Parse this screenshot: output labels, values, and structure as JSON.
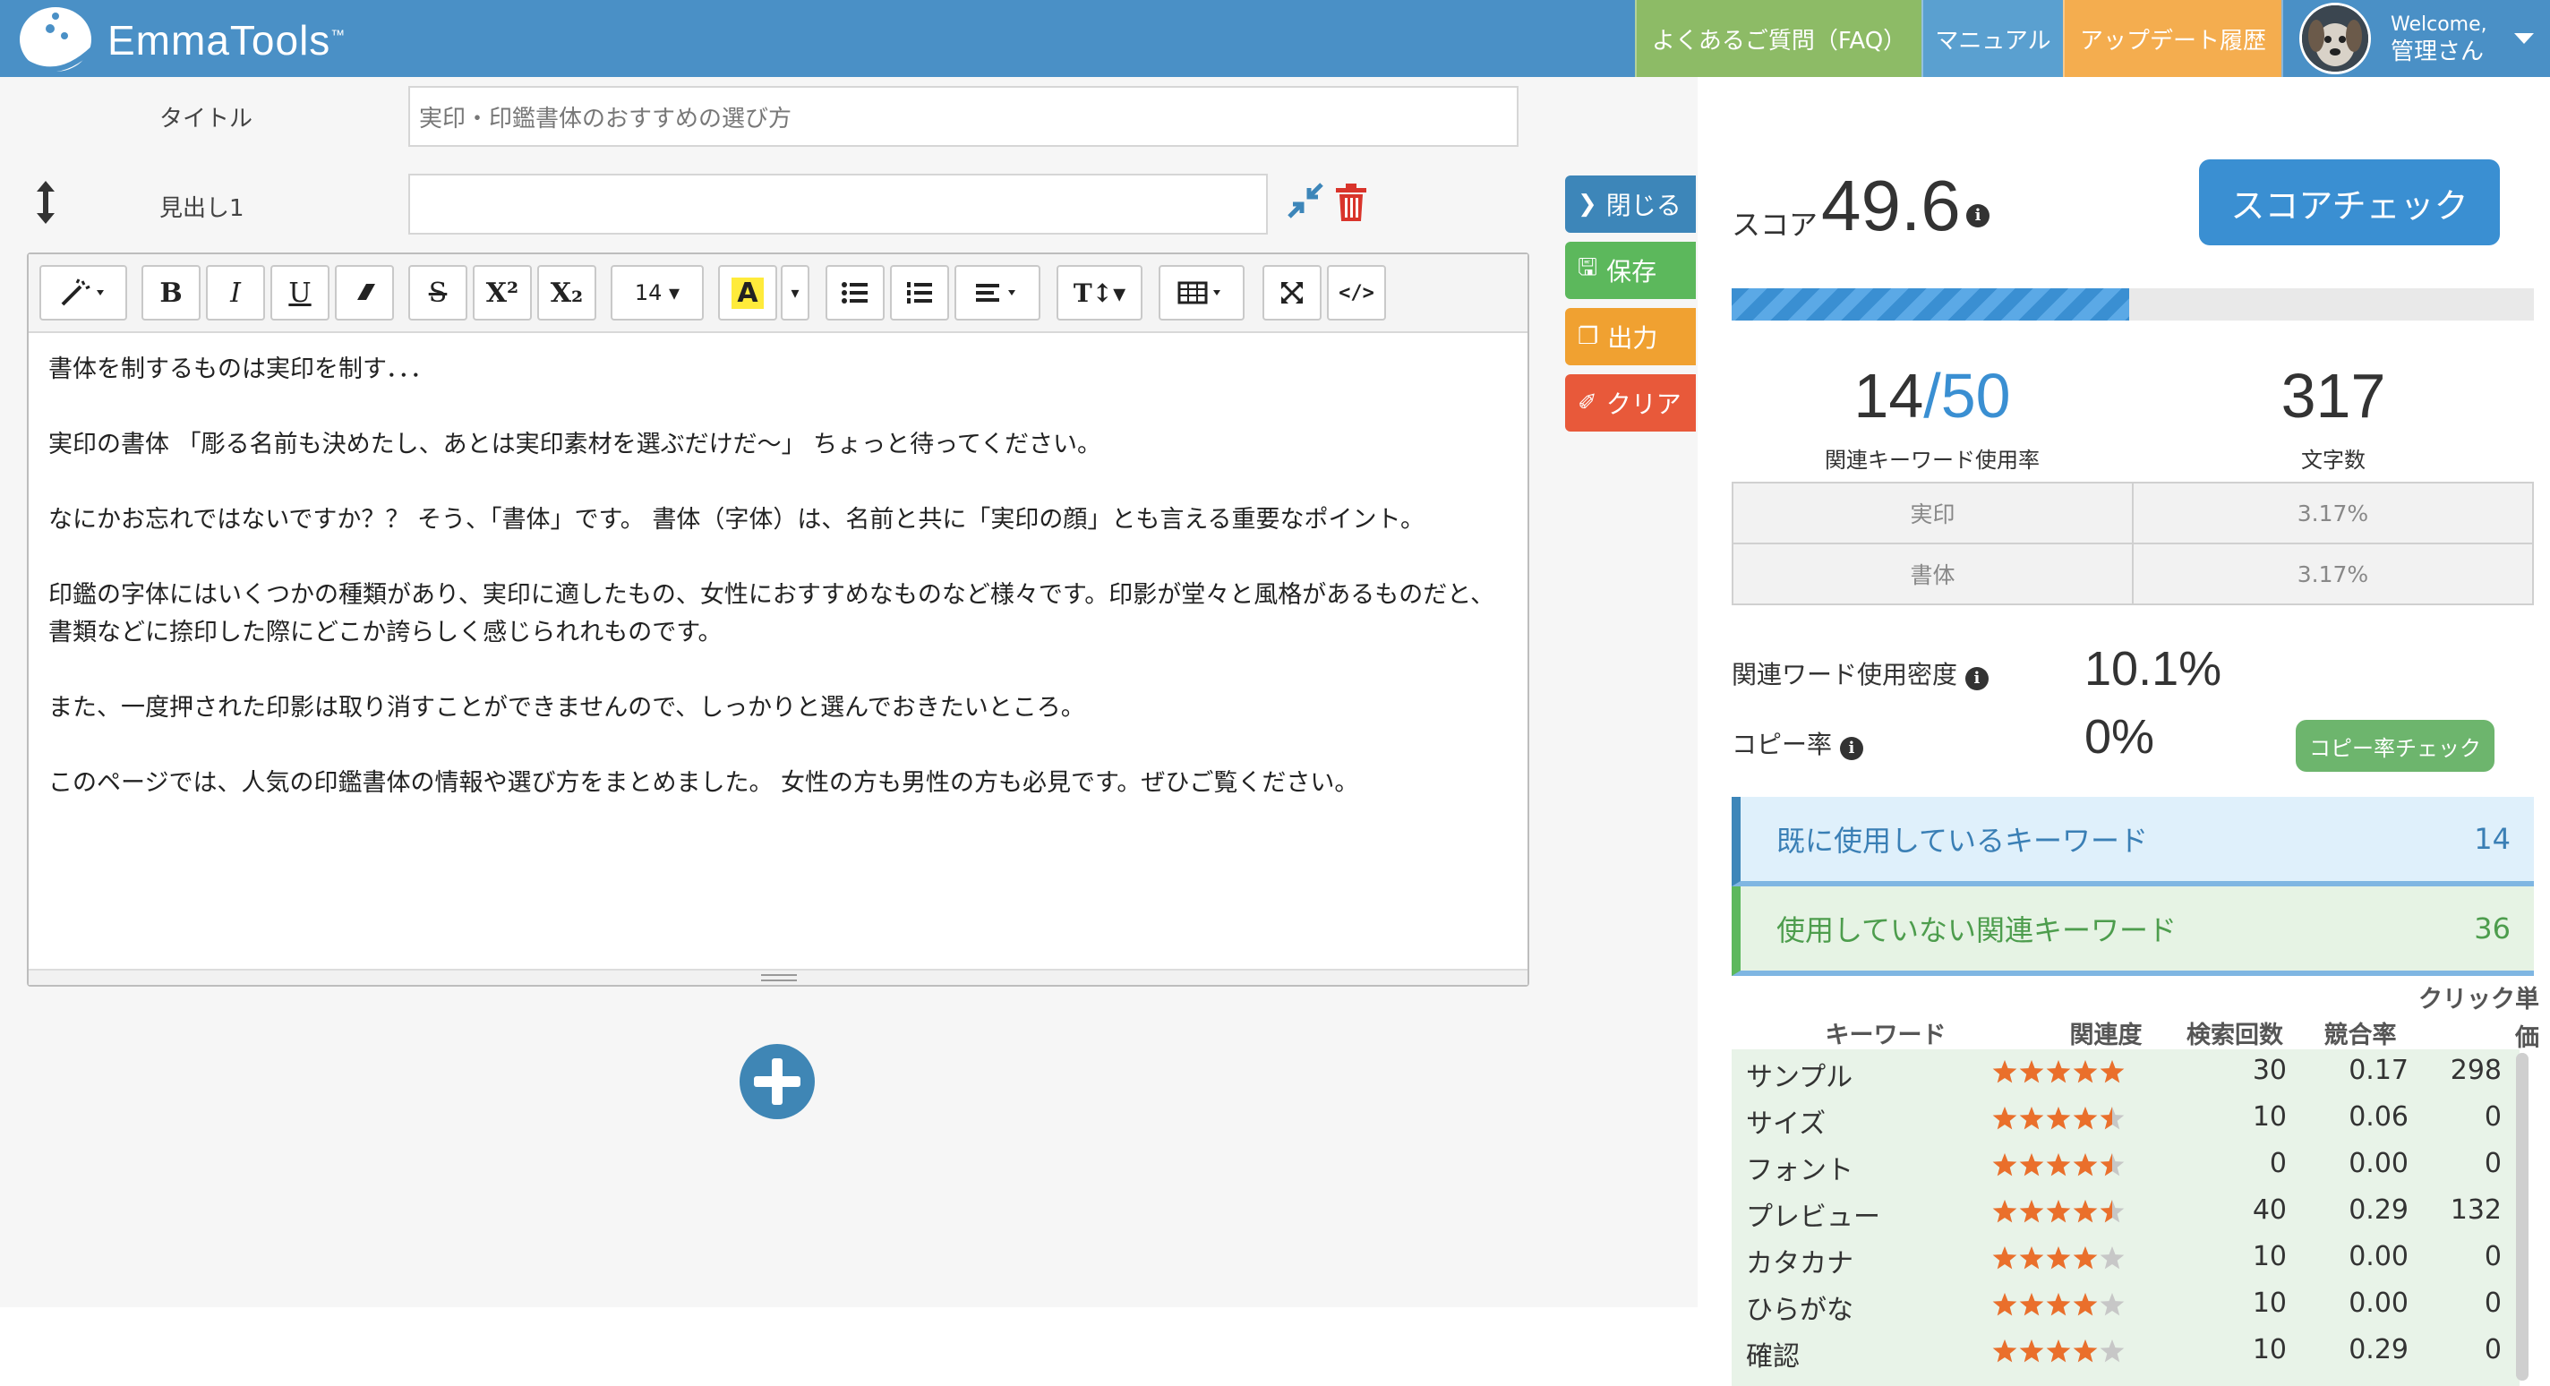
{
  "header": {
    "brand": "EmmaTools",
    "brand_tm": "™",
    "nav": {
      "faq": "よくあるご質問（FAQ）",
      "manual": "マニュアル",
      "update": "アップデート履歴"
    },
    "user": {
      "welcome": "Welcome,",
      "name": "管理さん"
    },
    "colors": {
      "bar": "#4a90c6",
      "faq": "#8dbb66",
      "manual": "#5aa0d0",
      "update": "#f4ad4f"
    }
  },
  "editor": {
    "title_label": "タイトル",
    "title_value": "実印・印鑑書体のおすすめの選び方",
    "heading_label": "見出し1",
    "heading_value": "",
    "toolbar": {
      "bold": "B",
      "italic": "I",
      "underline": "U",
      "strike": "S",
      "superscript": "X²",
      "subscript": "X₂",
      "font_size": "14 ▾",
      "highlight": "A",
      "text_style": "T↕▾",
      "code": "</>"
    },
    "paragraphs": [
      "書体を制するものは実印を制す．．．",
      "実印の書体 「彫る名前も決めたし、あとは実印素材を選ぶだけだ〜」 ちょっと待ってください。",
      "なにかお忘れではないですか？？ そう、「書体」です。 書体（字体）は、名前と共に「実印の顔」とも言える重要なポイント。",
      "印鑑の字体にはいくつかの種類があり、実印に適したもの、女性におすすめなものなど様々です。印影が堂々と風格があるものだと、書類などに捺印した際にどこか誇らしく感じられれものです。",
      "また、一度押された印影は取り消すことができませんので、しっかりと選んでおきたいところ。",
      "このページでは、人気の印鑑書体の情報や選び方をまとめました。 女性の方も男性の方も必見です。ぜひご覧ください。"
    ]
  },
  "actions": {
    "close": "閉じる",
    "save": "保存",
    "output": "出力",
    "clear": "クリア"
  },
  "score": {
    "label": "スコア",
    "value": "49.6",
    "check_button": "スコアチェック",
    "progress_percent": 49.6,
    "keywords_used": "14",
    "keywords_total": "/50",
    "keywords_label": "関連キーワード使用率",
    "char_count": "317",
    "char_label": "文字数",
    "keyword_rates": [
      {
        "word": "実印",
        "rate": "3.17%"
      },
      {
        "word": "書体",
        "rate": "3.17%"
      }
    ],
    "density_label": "関連ワード使用密度",
    "density_value": "10.1%",
    "copy_label": "コピー率",
    "copy_value": "0%",
    "copy_button": "コピー率チェック"
  },
  "keyword_sections": {
    "used": {
      "label": "既に使用しているキーワード",
      "count": "14"
    },
    "unused": {
      "label": "使用していない関連キーワード",
      "count": "36"
    }
  },
  "keyword_table": {
    "headers": {
      "keyword": "キーワード",
      "relevance": "関連度",
      "searches": "検索回数",
      "competition": "競合率",
      "cpc_1": "クリック単",
      "cpc_2": "価"
    },
    "rows": [
      {
        "keyword": "サンプル",
        "stars": 5,
        "searches": "30",
        "competition": "0.17",
        "cpc": "298"
      },
      {
        "keyword": "サイズ",
        "stars": 4.5,
        "searches": "10",
        "competition": "0.06",
        "cpc": "0"
      },
      {
        "keyword": "フォント",
        "stars": 4.5,
        "searches": "0",
        "competition": "0.00",
        "cpc": "0"
      },
      {
        "keyword": "プレビュー",
        "stars": 4.5,
        "searches": "40",
        "competition": "0.29",
        "cpc": "132"
      },
      {
        "keyword": "カタカナ",
        "stars": 4,
        "searches": "10",
        "competition": "0.00",
        "cpc": "0"
      },
      {
        "keyword": "ひらがな",
        "stars": 4,
        "searches": "10",
        "competition": "0.00",
        "cpc": "0"
      },
      {
        "keyword": "確認",
        "stars": 4,
        "searches": "10",
        "competition": "0.29",
        "cpc": "0"
      }
    ]
  },
  "icons": {
    "logo": "emma-logo-icon",
    "drag": "drag-vertical-icon",
    "shrink": "compress-icon",
    "trash": "trash-icon",
    "add": "plus-circle-icon",
    "close": "chevron-right-icon",
    "save": "save-icon",
    "output": "copy-icon",
    "clear": "eraser-icon",
    "info": "info-icon",
    "star": "star-icon"
  },
  "colors": {
    "accent_blue": "#3a8fd2",
    "star_orange": "#ea6f2b",
    "star_gray": "#c7c7c7",
    "clear_red": "#e8593a",
    "save_green": "#5cb85c",
    "output_orange": "#f0a131"
  }
}
